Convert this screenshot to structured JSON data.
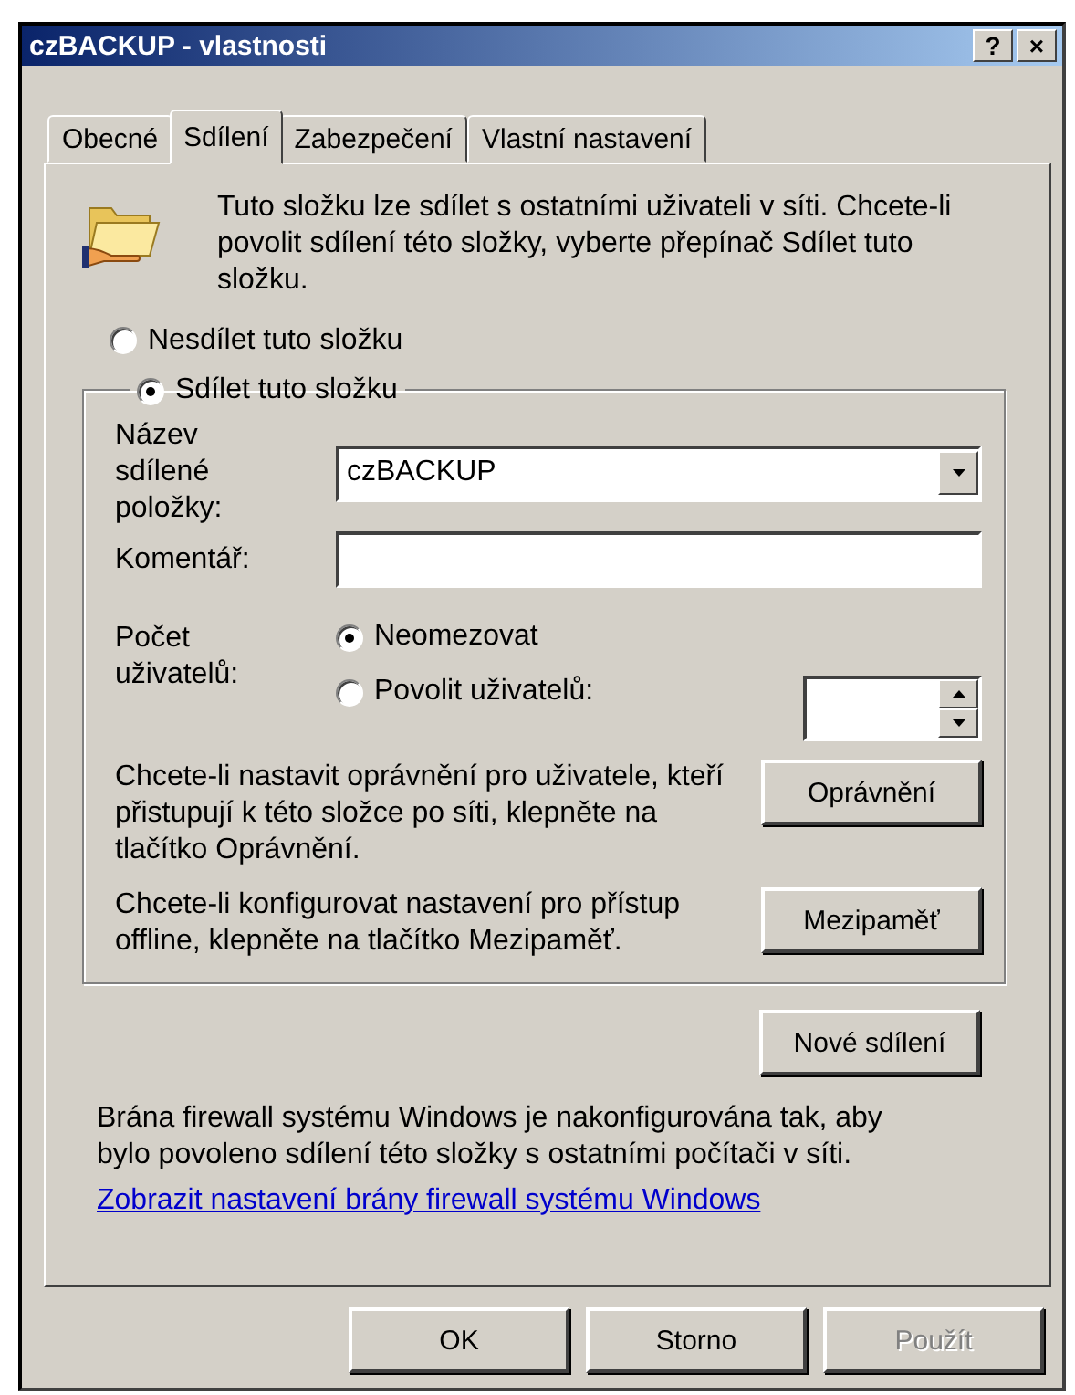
{
  "window": {
    "title": "czBACKUP - vlastnosti",
    "title_buttons": [
      "?",
      "×"
    ]
  },
  "tabs": [
    {
      "label": "Obecné",
      "selected": false
    },
    {
      "label": "Sdílení",
      "selected": true
    },
    {
      "label": "Zabezpečení",
      "selected": false
    },
    {
      "label": "Vlastní nastavení",
      "selected": false
    }
  ],
  "intro": "Tuto složku lze sdílet s ostatními uživateli v síti. Chcete-li povolit sdílení této složky, vyberte přepínač Sdílet tuto složku.",
  "share_options": [
    {
      "label": "Nesdílet tuto složku",
      "selected": false
    },
    {
      "label": "Sdílet tuto složku",
      "selected": true
    }
  ],
  "share_name": {
    "label": "Název sdílené položky:",
    "value": "czBACKUP"
  },
  "comment": {
    "label": "Komentář:"
  },
  "user_limit": {
    "label": "Počet uživatelů:",
    "options": [
      {
        "label": "Neomezovat",
        "selected": true
      },
      {
        "label": "Povolit uživatelů:",
        "selected": false
      }
    ]
  },
  "permissions": {
    "text": "Chcete-li nastavit oprávnění pro uživatele, kteří přistupují k této složce po síti, klepněte na tlačítko Oprávnění.",
    "button": "Oprávnění"
  },
  "caching": {
    "text": "Chcete-li konfigurovat nastavení pro přístup offline, klepněte na tlačítko Mezipaměť.",
    "button": "Mezipaměť"
  },
  "new_share_button": "Nové sdílení",
  "firewall": {
    "text": "Brána firewall systému Windows je nakonfigurována tak, aby bylo povoleno sdílení této složky s ostatními počítači v síti.",
    "link": "Zobrazit nastavení brány firewall systému Windows"
  },
  "buttons": [
    {
      "label": "OK",
      "disabled": false
    },
    {
      "label": "Storno",
      "disabled": false
    },
    {
      "label": "Použít",
      "disabled": true
    }
  ]
}
